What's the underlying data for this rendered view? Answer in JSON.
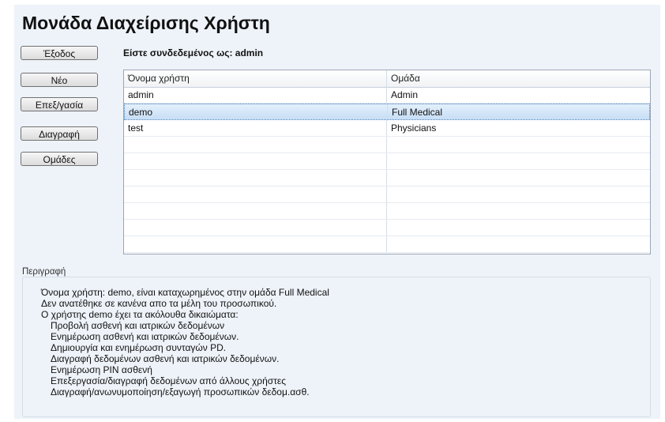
{
  "window": {
    "title": "Μονάδα Διαχείρισης Χρήστη"
  },
  "sidebar": {
    "buttons": [
      {
        "label": "Έξοδος"
      },
      {
        "label": "Νέο"
      },
      {
        "label": "Επεξ/γασία"
      },
      {
        "label": "Διαγραφή"
      },
      {
        "label": "Ομάδες"
      }
    ]
  },
  "status": {
    "logged_in": "Είστε συνδεδεμένος ως: admin"
  },
  "users_table": {
    "columns": [
      "Όνομα χρήστη",
      "Ομάδα"
    ],
    "rows": [
      {
        "username": "admin",
        "group": "Admin"
      },
      {
        "username": "demo",
        "group": "Full Medical",
        "selected": true
      },
      {
        "username": "test",
        "group": "Physicians"
      }
    ],
    "empty_row_count": 7
  },
  "description": {
    "legend": "Περιγραφή",
    "lines": [
      "Όνομα χρήστη: demo, είναι καταχωρημένος στην ομάδα Full Medical",
      "Δεν ανατέθηκε σε κανένα απο τα μέλη του προσωπικού.",
      "Ο χρήστης demo έχει τα ακόλουθα δικαιώματα:",
      "Προβολή ασθενή και ιατρικών δεδομένων",
      "Ενημέρωση ασθενή και ιατρικών δεδομένων.",
      "Δημιουργία και ενημέρωση συνταγών PD.",
      "Διαγραφή δεδομένων ασθενή και ιατρικών δεδομένων.",
      "Ενημέρωση PIN ασθενή",
      "Επεξεργασία/διαγραφή δεδομένων από άλλους χρήστες",
      "Διαγραφή/ανωνυμοποίηση/εξαγωγή προσωπικών δεδομ.ασθ."
    ]
  }
}
